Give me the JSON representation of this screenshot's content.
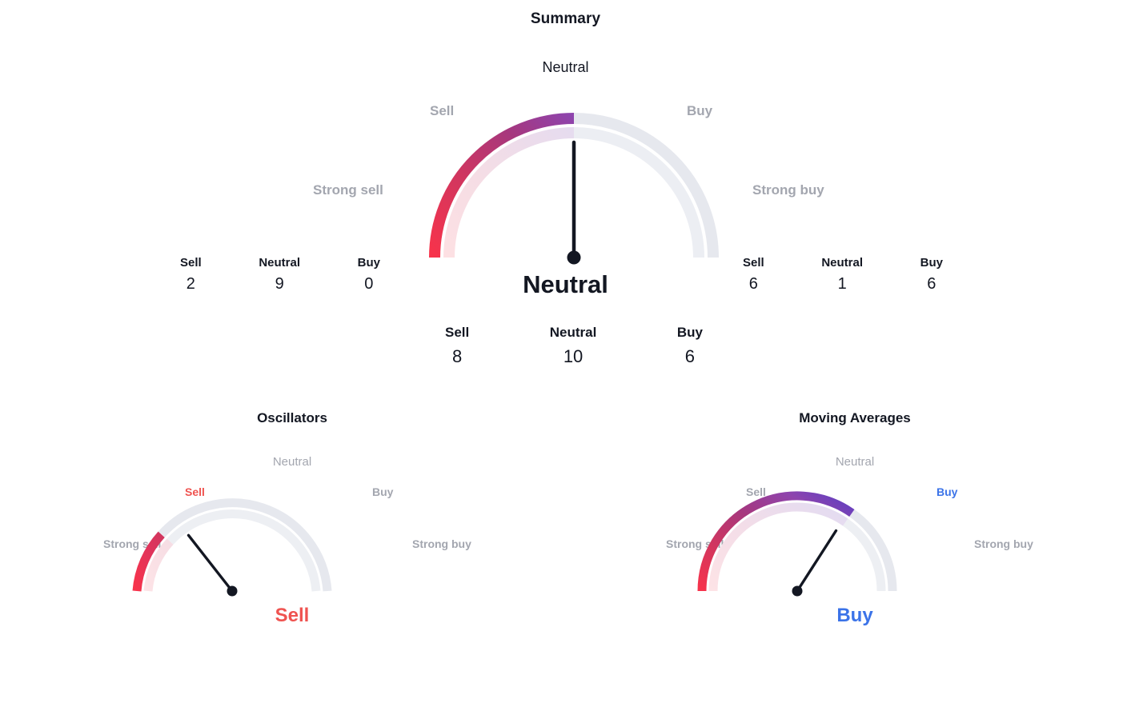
{
  "page": {
    "background": "#ffffff",
    "text_color": "#131722",
    "muted_label_color": "#a3a6af",
    "sell_color": "#ef5350",
    "buy_color": "#3b73e8",
    "track_color": "#e0e3eb"
  },
  "summary": {
    "title": "Summary",
    "subtitle": "Neutral",
    "verdict": "Neutral",
    "verdict_color": "#131722",
    "zone_labels": {
      "strong_sell": "Strong sell",
      "sell": "Sell",
      "neutral": "Neutral",
      "buy": "Buy",
      "strong_buy": "Strong buy"
    },
    "counts": [
      {
        "label": "Sell",
        "value": "8"
      },
      {
        "label": "Neutral",
        "value": "10"
      },
      {
        "label": "Buy",
        "value": "6"
      }
    ]
  },
  "oscillators": {
    "title": "Oscillators",
    "subtitle": "Neutral",
    "verdict": "Sell",
    "verdict_color": "#ef5350",
    "zone_labels": {
      "strong_sell": "Strong sell",
      "sell": "Sell",
      "neutral": "Neutral",
      "buy": "Buy",
      "strong_buy": "Strong buy"
    },
    "counts": [
      {
        "label": "Sell",
        "value": "2"
      },
      {
        "label": "Neutral",
        "value": "9"
      },
      {
        "label": "Buy",
        "value": "0"
      }
    ]
  },
  "moving_averages": {
    "title": "Moving Averages",
    "subtitle": "Neutral",
    "verdict": "Buy",
    "verdict_color": "#3b73e8",
    "zone_labels": {
      "strong_sell": "Strong sell",
      "sell": "Sell",
      "neutral": "Neutral",
      "buy": "Buy",
      "strong_buy": "Strong buy"
    },
    "counts": [
      {
        "label": "Sell",
        "value": "6"
      },
      {
        "label": "Neutral",
        "value": "1"
      },
      {
        "label": "Buy",
        "value": "6"
      }
    ]
  },
  "chart_data": {
    "type": "gauge",
    "title": "Summary",
    "scale": {
      "min": -1,
      "max": 1,
      "zones": [
        "Strong sell",
        "Sell",
        "Neutral",
        "Buy",
        "Strong buy"
      ],
      "arc_start_deg": 180,
      "arc_end_deg": 0
    },
    "gauges": [
      {
        "name": "Summary",
        "rating": "Neutral",
        "needle_angle_deg": 90,
        "filled_to_deg": 90,
        "gradient": [
          "#f7334b",
          "#d1365f",
          "#a6377e",
          "#8e44ad"
        ],
        "counts": {
          "Sell": 8,
          "Neutral": 10,
          "Buy": 6
        }
      },
      {
        "name": "Oscillators",
        "rating": "Sell",
        "needle_angle_deg": 128,
        "filled_to_deg": 140,
        "gradient": [
          "#f7334b",
          "#e3345a",
          "#d1365f"
        ],
        "counts": {
          "Sell": 2,
          "Neutral": 9,
          "Buy": 0
        }
      },
      {
        "name": "Moving Averages",
        "rating": "Buy",
        "needle_angle_deg": 58,
        "filled_to_deg": 55,
        "gradient": [
          "#f7334b",
          "#d1365f",
          "#a6377e",
          "#8e44ad",
          "#5b3fc4"
        ],
        "counts": {
          "Sell": 6,
          "Neutral": 1,
          "Buy": 6
        }
      }
    ]
  }
}
